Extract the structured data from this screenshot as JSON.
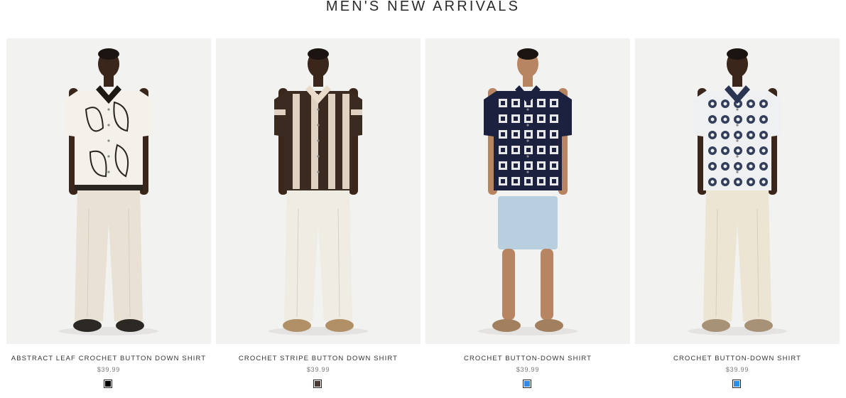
{
  "page": {
    "title": "MEN'S NEW ARRIVALS"
  },
  "products": [
    {
      "name": "ABSTRACT LEAF CROCHET BUTTON DOWN SHIRT",
      "price": "$39.99",
      "swatch_color": "#000000",
      "shirt_color": "#f3f1ea",
      "shirt_accent": "#1d1a16",
      "bottom_color": "#e8e1d4",
      "shoe_color": "#2c2824",
      "skin_color": "#3a261a"
    },
    {
      "name": "CROCHET STRIPE BUTTON DOWN SHIRT",
      "price": "$39.99",
      "swatch_color": "#4a3a36",
      "shirt_color": "#3b2a20",
      "shirt_accent": "#e9dccb",
      "bottom_color": "#efece4",
      "shoe_color": "#b29067",
      "skin_color": "#3a261a"
    },
    {
      "name": "CROCHET BUTTON-DOWN SHIRT",
      "price": "$39.99",
      "swatch_color": "#2f8de4",
      "shirt_color": "#1c2140",
      "shirt_accent": "#f2f2f2",
      "bottom_color": "#b8cfe0",
      "shoe_color": "#a27f5e",
      "skin_color": "#b88563"
    },
    {
      "name": "CROCHET BUTTON-DOWN SHIRT",
      "price": "$39.99",
      "swatch_color": "#2f8de4",
      "shirt_color": "#eef0f2",
      "shirt_accent": "#2a3552",
      "bottom_color": "#ede5d4",
      "shoe_color": "#a89277",
      "skin_color": "#3a261a"
    }
  ]
}
